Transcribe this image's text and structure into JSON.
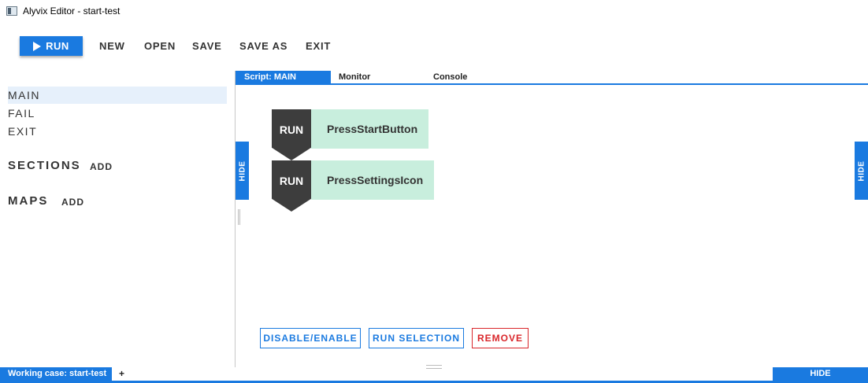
{
  "window": {
    "title": "Alyvix Editor - start-test"
  },
  "toolbar": {
    "run_label": "RUN",
    "new_label": "NEW",
    "open_label": "OPEN",
    "save_label": "SAVE",
    "save_as_label": "SAVE AS",
    "exit_label": "EXIT"
  },
  "left_panel": {
    "scripts": [
      {
        "label": "MAIN",
        "selected": true
      },
      {
        "label": "FAIL",
        "selected": false
      },
      {
        "label": "EXIT",
        "selected": false
      }
    ],
    "sections_label": "SECTIONS",
    "sections_add": "ADD",
    "maps_label": "MAPS",
    "maps_add": "ADD"
  },
  "tabs": [
    {
      "label": "Script: MAIN",
      "active": true
    },
    {
      "label": "Monitor",
      "active": false
    },
    {
      "label": "Console",
      "active": false
    }
  ],
  "side_hide": {
    "left": "HIDE",
    "right": "HIDE"
  },
  "script_nodes": [
    {
      "action": "RUN",
      "name": "PressStartButton"
    },
    {
      "action": "RUN",
      "name": "PressSettingsIcon"
    }
  ],
  "actions": {
    "disable_enable": "DISABLE/ENABLE",
    "run_selection": "RUN SELECTION",
    "remove": "REMOVE"
  },
  "statusbar": {
    "working_case": "Working case: start-test",
    "add": "+",
    "hide": "HIDE"
  },
  "colors": {
    "accent": "#1a7ae0",
    "node_dark": "#3d3d3d",
    "node_label_bg": "#c8eedd",
    "danger": "#d9262a"
  }
}
